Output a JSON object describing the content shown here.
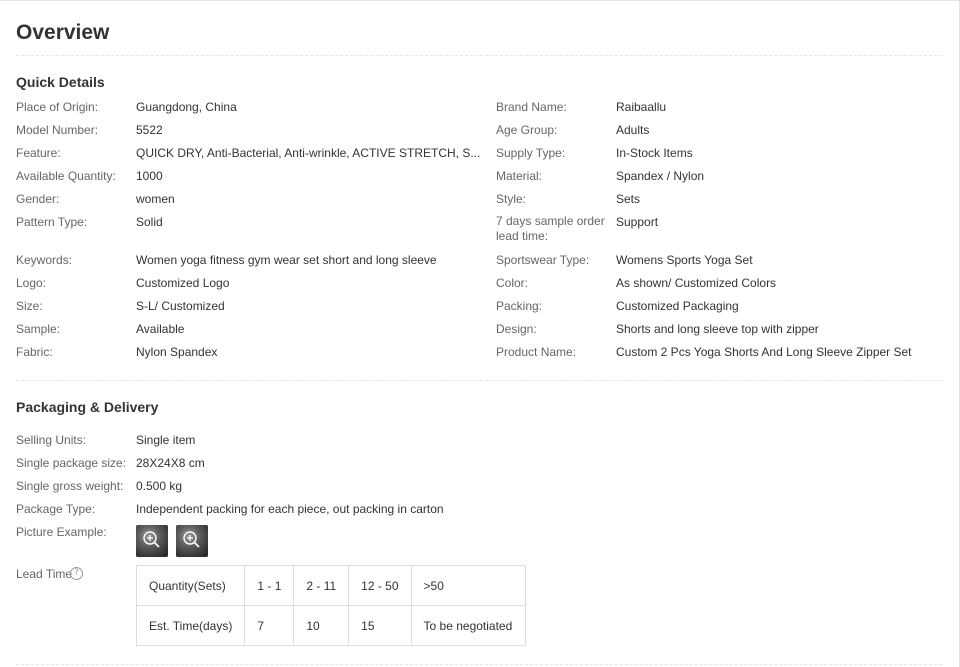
{
  "title": "Overview",
  "quick_details": {
    "heading": "Quick Details",
    "left": [
      {
        "label": "Place of Origin:",
        "value": "Guangdong, China"
      },
      {
        "label": "Model Number:",
        "value": "5522"
      },
      {
        "label": "Feature:",
        "value": "QUICK DRY, Anti-Bacterial, Anti-wrinkle, ACTIVE STRETCH, S..."
      },
      {
        "label": "Available Quantity:",
        "value": "1000"
      },
      {
        "label": "Gender:",
        "value": "women"
      },
      {
        "label": "Pattern Type:",
        "value": "Solid"
      },
      {
        "label": "Keywords:",
        "value": "Women yoga fitness gym wear set short and long sleeve"
      },
      {
        "label": "Logo:",
        "value": "Customized Logo"
      },
      {
        "label": "Size:",
        "value": "S-L/ Customized"
      },
      {
        "label": "Sample:",
        "value": "Available"
      },
      {
        "label": "Fabric:",
        "value": "Nylon Spandex"
      }
    ],
    "right": [
      {
        "label": "Brand Name:",
        "value": "Raibaallu"
      },
      {
        "label": "Age Group:",
        "value": "Adults"
      },
      {
        "label": "Supply Type:",
        "value": "In-Stock Items"
      },
      {
        "label": "Material:",
        "value": "Spandex / Nylon"
      },
      {
        "label": "Style:",
        "value": "Sets"
      },
      {
        "label": "7 days sample order lead time:",
        "value": "Support"
      },
      {
        "label": "Sportswear Type:",
        "value": "Womens Sports Yoga Set"
      },
      {
        "label": "Color:",
        "value": "As shown/ Customized Colors"
      },
      {
        "label": "Packing:",
        "value": "Customized Packaging"
      },
      {
        "label": "Design:",
        "value": "Shorts and long sleeve top with zipper"
      },
      {
        "label": "Product Name:",
        "value": "Custom 2 Pcs Yoga Shorts And Long Sleeve Zipper Set"
      }
    ]
  },
  "packaging": {
    "heading": "Packaging & Delivery",
    "items": [
      {
        "label": "Selling Units:",
        "value": "Single item"
      },
      {
        "label": "Single package size:",
        "value": "28X24X8 cm"
      },
      {
        "label": "Single gross weight:",
        "value": "0.500 kg"
      },
      {
        "label": "Package Type:",
        "value": "Independent packing for each piece, out packing in carton"
      }
    ],
    "picture_label": "Picture Example:",
    "thumbnail_icon": "zoom-in-icon",
    "lead_label": "Lead Time",
    "help_icon": "?",
    "lead_table": {
      "row1": [
        "Quantity(Sets)",
        "1 - 1",
        "2 - 11",
        "12 - 50",
        ">50"
      ],
      "row2": [
        "Est. Time(days)",
        "7",
        "10",
        "15",
        "To be negotiated"
      ]
    }
  }
}
